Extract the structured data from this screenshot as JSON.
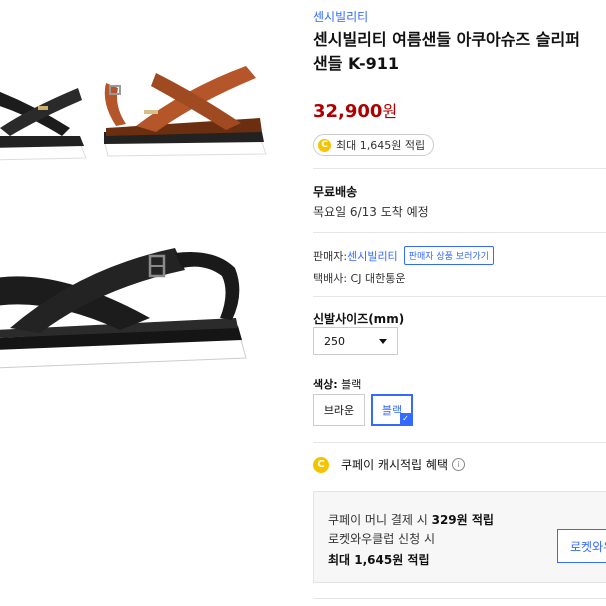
{
  "product": {
    "brand": "센시빌리티",
    "title_line1": "센시빌리티 여름샌들 아쿠아슈즈 슬리퍼",
    "title_line2": "샌들 K-911",
    "price": "32,900",
    "price_unit": "원"
  },
  "cashback": {
    "coin_symbol": "C",
    "text": "최대 1,645원 적립"
  },
  "shipping": {
    "title": "무료배송",
    "arrival": "목요일 6/13 도착 예정"
  },
  "seller": {
    "label": "판매자:",
    "name": "센시빌리티",
    "button": "판매자 상품 보러가기",
    "courier": "택배사: CJ 대한통운"
  },
  "size": {
    "label": "신발사이즈(mm)",
    "selected": "250"
  },
  "color": {
    "label_prefix": "색상:",
    "selected": "블랙",
    "options": [
      "브라운",
      "블랙"
    ]
  },
  "benefit": {
    "coin_symbol": "C",
    "title": "쿠페이 캐시적립 혜택",
    "info_symbol": "i"
  },
  "cash_box": {
    "line1_prefix": "쿠페이 머니 결제 시",
    "line1_amount": "329원 적립",
    "line2": "로켓와우클럽 신청 시",
    "line3": "최대 1,645원 적립",
    "button": "로켓와우"
  },
  "colors": {
    "accent_blue": "#346aff",
    "price_red": "#ae0000",
    "coin_yellow": "#f5c400",
    "leather_black": "#1c1c1c",
    "leather_brown": "#b5562a"
  }
}
